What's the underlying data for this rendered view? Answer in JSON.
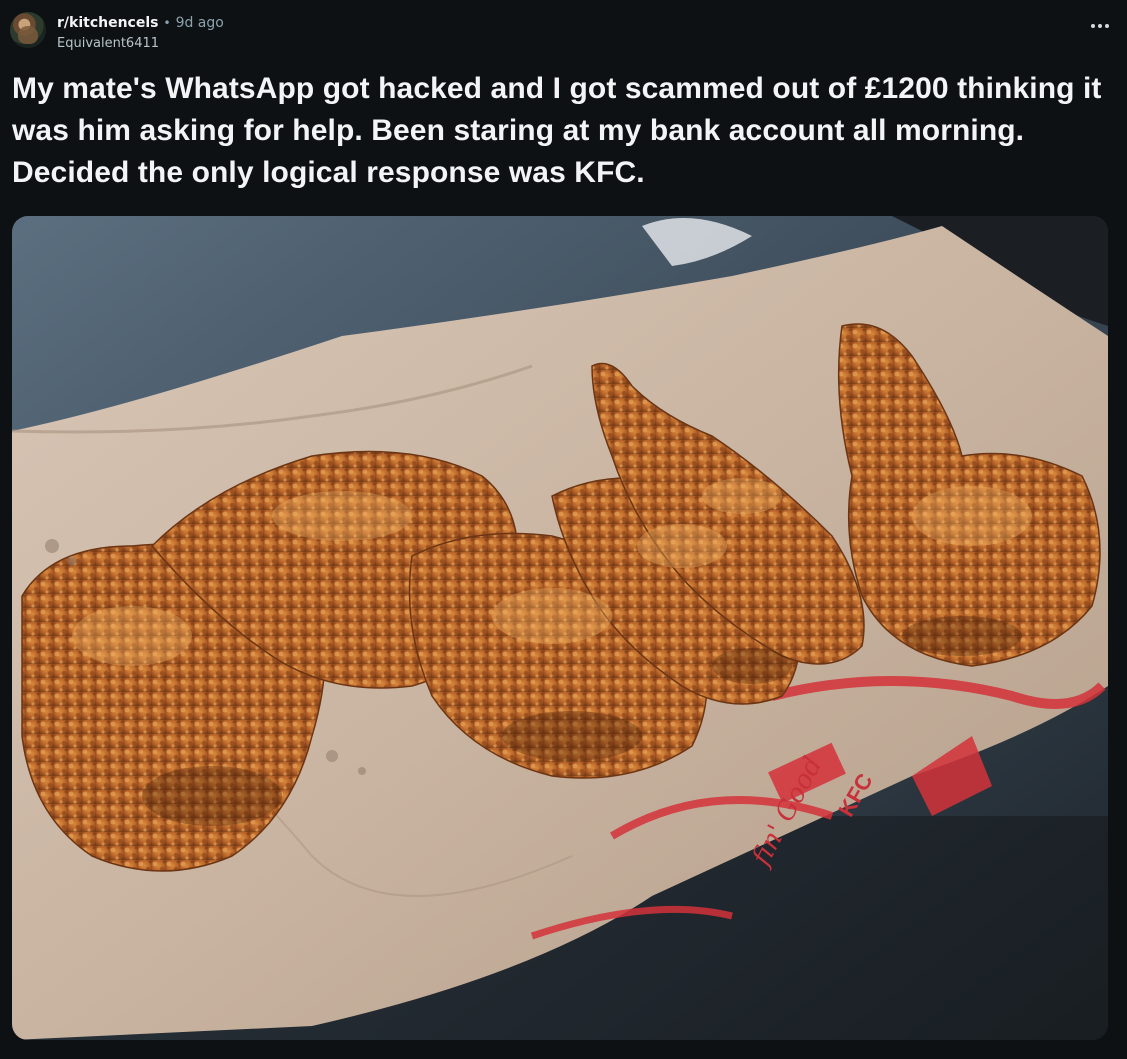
{
  "post": {
    "subreddit": "r/kitchencels",
    "separator": "•",
    "time_ago": "9d ago",
    "author": "Equivalent6411",
    "title": "My mate's WhatsApp got hacked and I got scammed out of £1200 thinking it was him asking for help. Been staring at my bank account all morning. Decided the only logical response was KFC."
  },
  "media": {
    "wrapper_text": "fin' Good",
    "brand_text": "KFC"
  },
  "colors": {
    "background": "#0e1113",
    "text_primary": "#f2f4f5",
    "text_secondary": "#8ba2ad",
    "accent_red": "#d4323a"
  },
  "icons": {
    "overflow_menu": "more-horizontal-icon"
  }
}
